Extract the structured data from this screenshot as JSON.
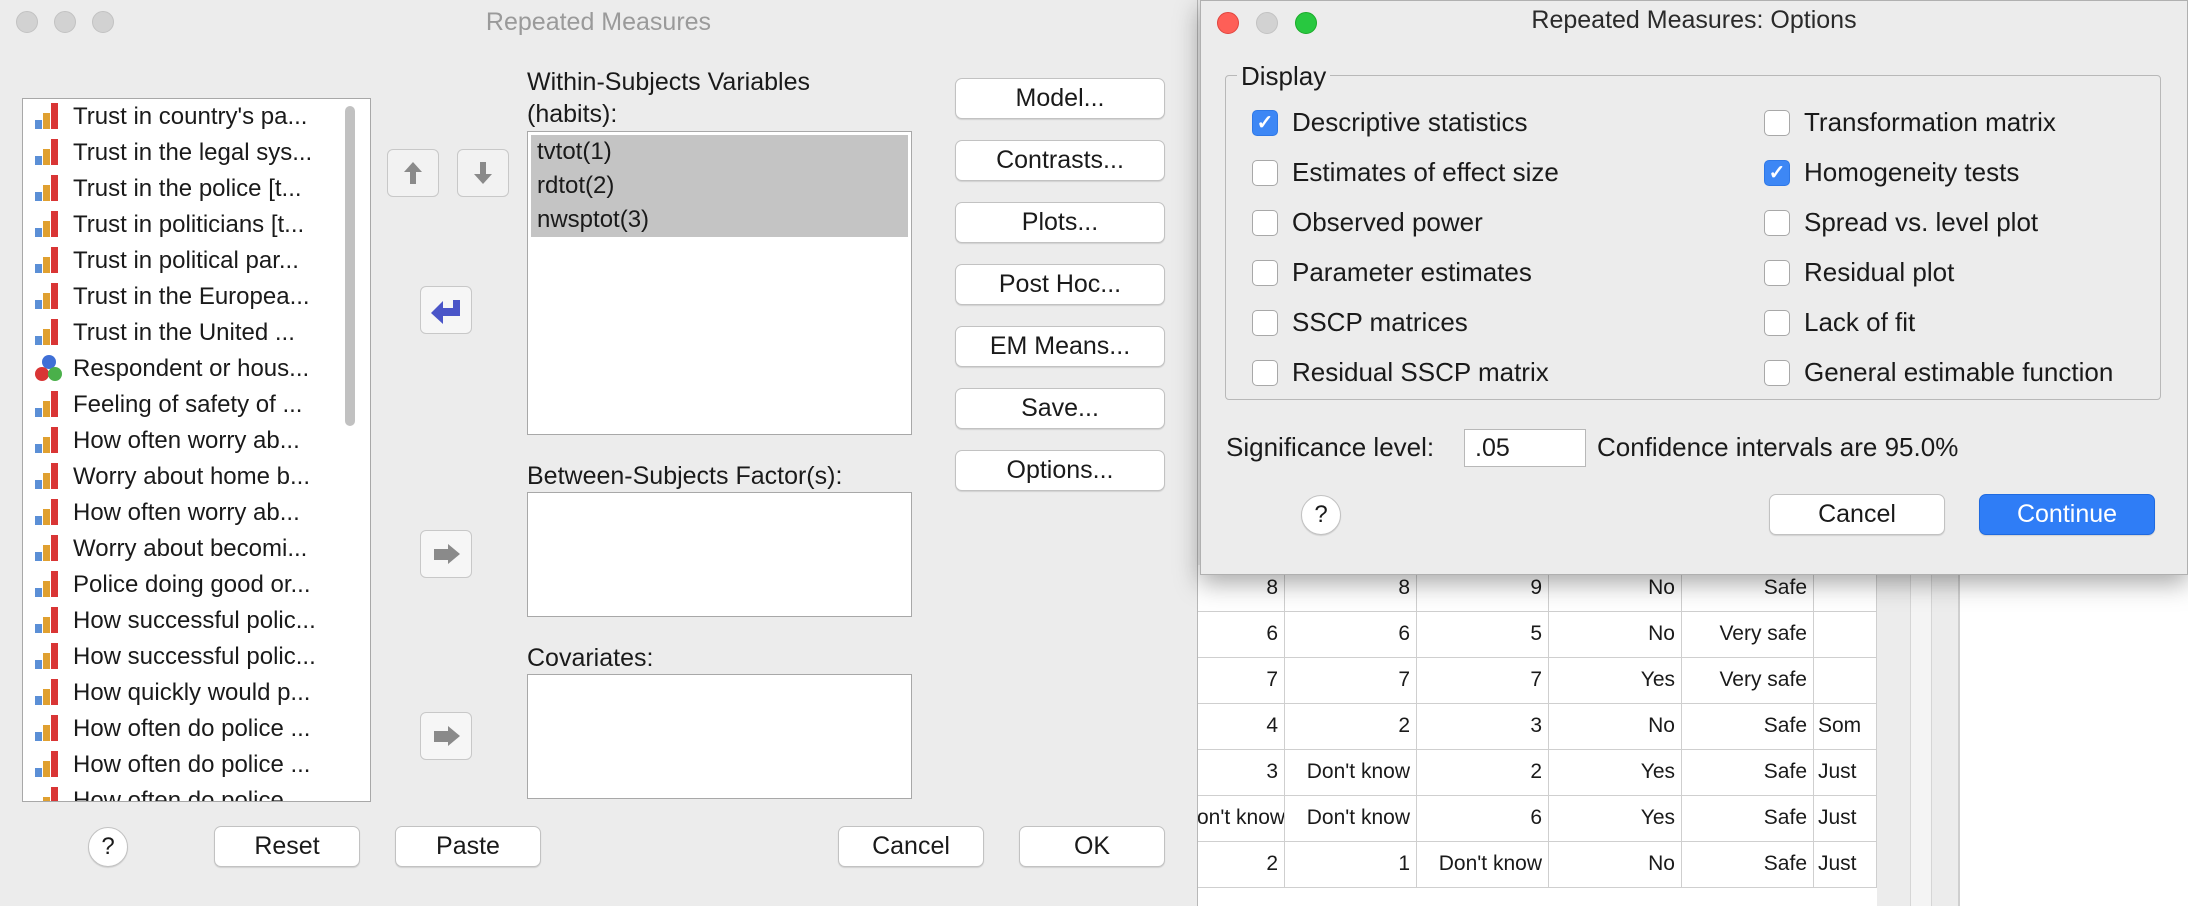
{
  "rm_dialog": {
    "title": "Repeated Measures",
    "variables": [
      {
        "label": "Trust in country's pa...",
        "icon": "scale-icon"
      },
      {
        "label": "Trust in the legal sys...",
        "icon": "scale-icon"
      },
      {
        "label": "Trust in the police [t...",
        "icon": "scale-icon"
      },
      {
        "label": "Trust in politicians [t...",
        "icon": "scale-icon"
      },
      {
        "label": "Trust in political par...",
        "icon": "scale-icon"
      },
      {
        "label": "Trust in the Europea...",
        "icon": "scale-icon"
      },
      {
        "label": "Trust in the United ...",
        "icon": "scale-icon"
      },
      {
        "label": "Respondent or hous...",
        "icon": "nominal-icon"
      },
      {
        "label": "Feeling of safety of ...",
        "icon": "scale-icon"
      },
      {
        "label": "How often worry ab...",
        "icon": "scale-icon"
      },
      {
        "label": "Worry about home b...",
        "icon": "scale-icon"
      },
      {
        "label": "How often worry ab...",
        "icon": "scale-icon"
      },
      {
        "label": "Worry about becomi...",
        "icon": "scale-icon"
      },
      {
        "label": "Police doing good or...",
        "icon": "scale-icon"
      },
      {
        "label": "How successful polic...",
        "icon": "scale-icon"
      },
      {
        "label": "How successful polic...",
        "icon": "scale-icon"
      },
      {
        "label": "How quickly would p...",
        "icon": "scale-icon"
      },
      {
        "label": "How often do police ...",
        "icon": "scale-icon"
      },
      {
        "label": "How often do police ...",
        "icon": "scale-icon"
      },
      {
        "label": "How often do police ...",
        "icon": "scale-icon"
      }
    ],
    "within_label_line1": "Within-Subjects Variables",
    "within_label_line2": "(habits):",
    "within_items": [
      "tvtot(1)",
      "rdtot(2)",
      "nwsptot(3)"
    ],
    "between_label": "Between-Subjects Factor(s):",
    "covariates_label": "Covariates:",
    "side_buttons": {
      "model": "Model...",
      "contrasts": "Contrasts...",
      "plots": "Plots...",
      "post_hoc": "Post Hoc...",
      "em_means": "EM Means...",
      "save": "Save...",
      "options": "Options..."
    },
    "footer": {
      "help": "?",
      "reset": "Reset",
      "paste": "Paste",
      "cancel": "Cancel",
      "ok": "OK"
    }
  },
  "options_dialog": {
    "title": "Repeated Measures: Options",
    "display_label": "Display",
    "left_options": [
      {
        "label": "Descriptive statistics",
        "checked": true
      },
      {
        "label": "Estimates of effect size",
        "checked": false
      },
      {
        "label": "Observed power",
        "checked": false
      },
      {
        "label": "Parameter estimates",
        "checked": false
      },
      {
        "label": "SSCP matrices",
        "checked": false
      },
      {
        "label": "Residual SSCP matrix",
        "checked": false
      }
    ],
    "right_options": [
      {
        "label": "Transformation matrix",
        "checked": false
      },
      {
        "label": "Homogeneity tests",
        "checked": true
      },
      {
        "label": "Spread vs. level plot",
        "checked": false
      },
      {
        "label": "Residual plot",
        "checked": false
      },
      {
        "label": "Lack of fit",
        "checked": false
      },
      {
        "label": "General estimable function",
        "checked": false
      }
    ],
    "significance_label": "Significance level:",
    "significance_value": ".05",
    "confidence_text": "Confidence intervals are 95.0%",
    "help": "?",
    "cancel": "Cancel",
    "continue": "Continue",
    "accent_color": "#2f7df6"
  },
  "data_grid": {
    "rows": [
      [
        "8",
        "8",
        "9",
        "No",
        "Safe",
        ""
      ],
      [
        "6",
        "6",
        "5",
        "No",
        "Very safe",
        ""
      ],
      [
        "7",
        "7",
        "7",
        "Yes",
        "Very safe",
        ""
      ],
      [
        "4",
        "2",
        "3",
        "No",
        "Safe",
        "Som"
      ],
      [
        "3",
        "Don't know",
        "2",
        "Yes",
        "Safe",
        "Just"
      ],
      [
        "on't know",
        "Don't know",
        "6",
        "Yes",
        "Safe",
        "Just"
      ],
      [
        "2",
        "1",
        "Don't know",
        "No",
        "Safe",
        "Just"
      ]
    ]
  }
}
